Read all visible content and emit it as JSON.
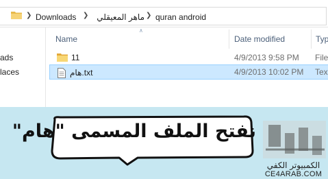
{
  "breadcrumb": {
    "items": [
      "Downloads",
      "ماهر المعيقلي",
      "quran android"
    ]
  },
  "nav": {
    "items": [
      "ads",
      "laces"
    ]
  },
  "columns": {
    "name": "Name",
    "date_modified": "Date modified",
    "type": "Typ"
  },
  "files": [
    {
      "name": "11",
      "date": "4/9/2013 9:58 PM",
      "type": "File",
      "icon": "folder-icon",
      "selected": false
    },
    {
      "name": "هام.txt",
      "date": "4/9/2013 10:02 PM",
      "type": "Tex",
      "icon": "text-file-icon",
      "selected": true
    }
  ],
  "caption": {
    "text": "نفتح الملف المسمى \"هام\""
  },
  "logo": {
    "arabic": "الكمبيوتر الكفي",
    "latin": "CE4ARAB.COM"
  },
  "colors": {
    "selection_bg": "#cce8ff",
    "selection_border": "#99d1ff",
    "banner_bg": "#c6e7f1",
    "column_header": "#4c607a"
  }
}
